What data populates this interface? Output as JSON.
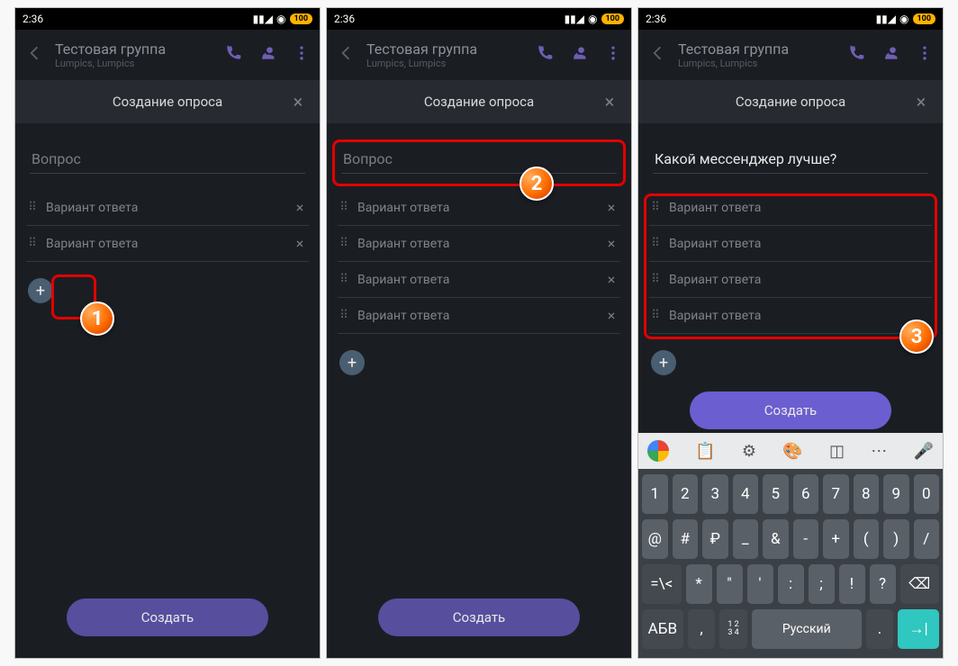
{
  "status": {
    "time": "2:36",
    "battery": "100"
  },
  "header": {
    "title": "Тестовая группа",
    "subtitle": "Lumpics, Lumpics"
  },
  "subheader": {
    "title": "Создание опроса"
  },
  "labels": {
    "question_placeholder": "Вопрос",
    "option_placeholder": "Вариант ответа",
    "create": "Создать"
  },
  "screen3": {
    "question": "Какой мессенджер лучше?"
  },
  "badges": {
    "s1": "1",
    "s2": "2",
    "s3": "3"
  },
  "keyboard": {
    "row1": [
      "1",
      "2",
      "3",
      "4",
      "5",
      "6",
      "7",
      "8",
      "9",
      "0"
    ],
    "row2": [
      "@",
      "#",
      "₽",
      "_",
      "&",
      "-",
      "+",
      "(",
      ")",
      "/"
    ],
    "row3_left": "=\\<",
    "row3": [
      "*",
      "\"",
      "'",
      ":",
      ";",
      "!",
      "?"
    ],
    "row4": {
      "mode": "АБВ",
      "lang": "Русский",
      "numpad": "1234"
    }
  }
}
